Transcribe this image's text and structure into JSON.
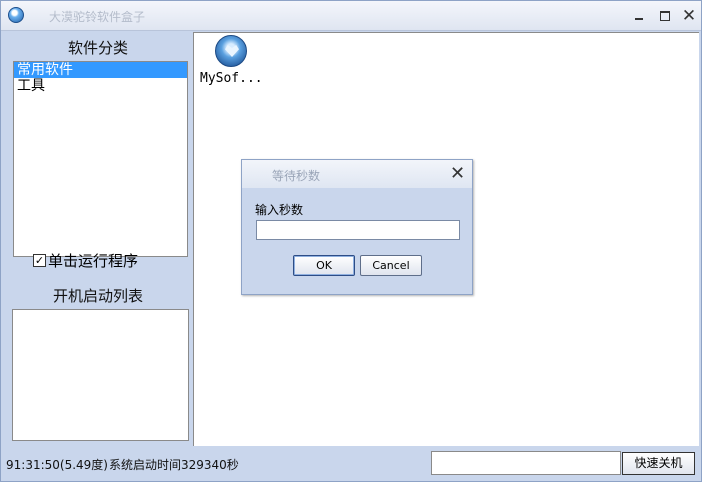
{
  "window": {
    "title": "大漠驼铃软件盒子",
    "icon": "app-globe-icon"
  },
  "left_panel": {
    "category_heading": "软件分类",
    "categories": [
      {
        "label": "常用软件",
        "selected": true
      },
      {
        "label": "工具",
        "selected": false
      }
    ],
    "single_click_checkbox": {
      "label": "单击运行程序",
      "checked": true,
      "mark": "☑"
    },
    "boot_heading": "开机启动列表"
  },
  "main": {
    "software_items": [
      {
        "label": "MySof...",
        "icon": "heart-globe-icon"
      }
    ]
  },
  "dialog": {
    "title": "等待秒数",
    "field_label": "输入秒数",
    "input_value": "",
    "ok_label": "OK",
    "cancel_label": "Cancel"
  },
  "status": {
    "time_text": "91:31:50(5.49度)",
    "uptime_text": "系统启动时间329340秒",
    "input_value": "",
    "shutdown_label": "快速关机"
  },
  "colors": {
    "panel_bg": "#c9d6ec",
    "selection": "#3399ff"
  }
}
